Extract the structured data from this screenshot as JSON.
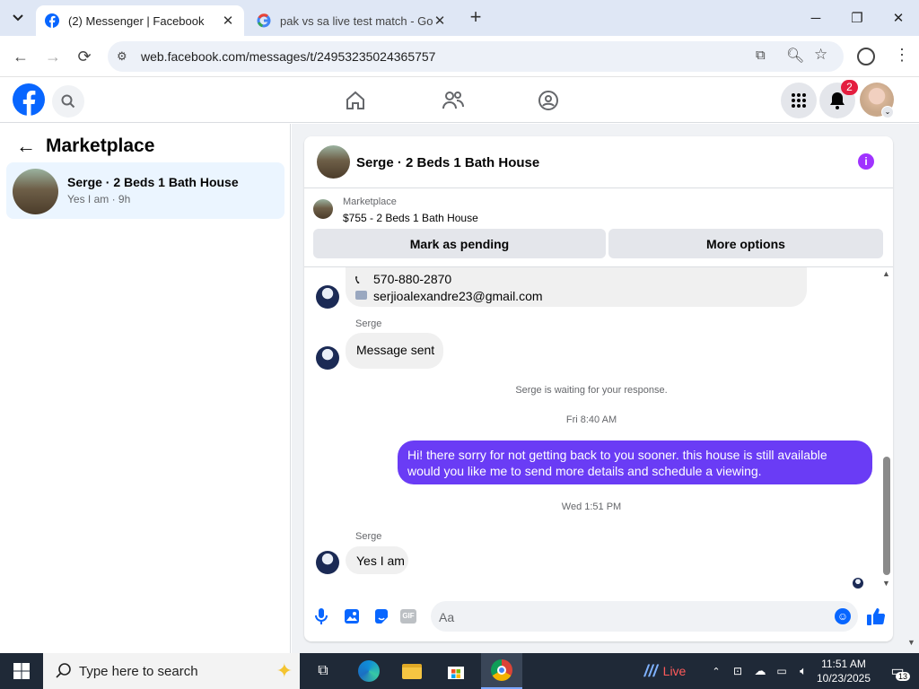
{
  "browser": {
    "tabs": [
      {
        "title": "(2) Messenger | Facebook"
      },
      {
        "title": "pak vs sa live test match - Goog"
      }
    ],
    "url": "web.facebook.com/messages/t/24953235024365757"
  },
  "facebook": {
    "notif_count": "2"
  },
  "sidebar": {
    "title": "Marketplace",
    "items": [
      {
        "title": "Serge · 2 Beds 1 Bath House",
        "preview": "Yes I am · 9h"
      }
    ]
  },
  "chat": {
    "header_title": "Serge · 2 Beds 1 Bath House",
    "listing_label": "Marketplace",
    "listing_title": "$755 - 2 Beds 1 Bath House",
    "mark_pending": "Mark as pending",
    "more_options": "More options",
    "phone": "570-880-2870",
    "email": "serjioalexandre23@gmail.com",
    "sender_name_1": "Serge",
    "msg_sent": "Message sent",
    "waiting_note": "Serge is waiting for your response.",
    "time_1": "Fri 8:40 AM",
    "outgoing": "Hi! there sorry for not getting back to you sooner. this house is still available would you like me to send more details and schedule a viewing.",
    "time_2": "Wed 1:51 PM",
    "sender_name_2": "Serge",
    "reply": "Yes I am",
    "composer_placeholder": "Aa"
  },
  "taskbar": {
    "search_placeholder": "Type here to search",
    "live_label": "Live",
    "time": "11:51 AM",
    "date": "10/23/2025",
    "notif_count": "13"
  },
  "colors": {
    "fb_blue": "#0866ff",
    "messenger_purple": "#6a3cf5",
    "bubble_gray": "#f0f0f0"
  }
}
